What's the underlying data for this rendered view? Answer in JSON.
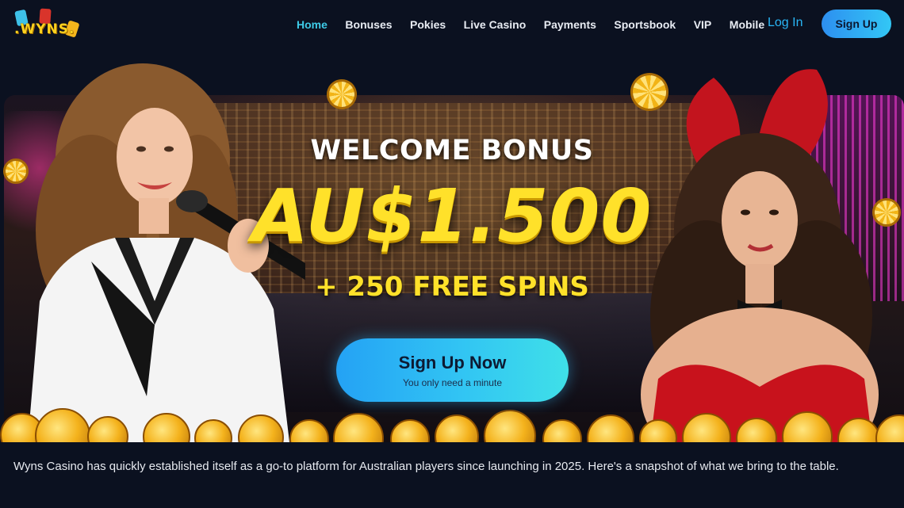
{
  "brand": {
    "logo_text": ".WYNS."
  },
  "nav": {
    "items": [
      {
        "label": "Home",
        "active": true
      },
      {
        "label": "Bonuses",
        "active": false
      },
      {
        "label": "Pokies",
        "active": false
      },
      {
        "label": "Live Casino",
        "active": false
      },
      {
        "label": "Payments",
        "active": false
      },
      {
        "label": "Sportsbook",
        "active": false
      },
      {
        "label": "VIP",
        "active": false
      },
      {
        "label": "Mobile",
        "active": false
      }
    ],
    "login_label": "Log In",
    "signup_label": "Sign Up"
  },
  "hero": {
    "title": "WELCOME BONUS",
    "amount": "AU$1.500",
    "spins": "+ 250 FREE SPINS",
    "cta_label": "Sign Up Now",
    "cta_sub": "You only need a minute"
  },
  "intro": {
    "text": "Wyns Casino has quickly established itself as a go-to platform for Australian players since launching in 2025. Here's a snapshot of what we bring to the table."
  },
  "colors": {
    "background": "#0b1120",
    "accent_cyan": "#3ecbe7",
    "login_blue": "#29b6f6",
    "gold": "#ffe12a"
  }
}
